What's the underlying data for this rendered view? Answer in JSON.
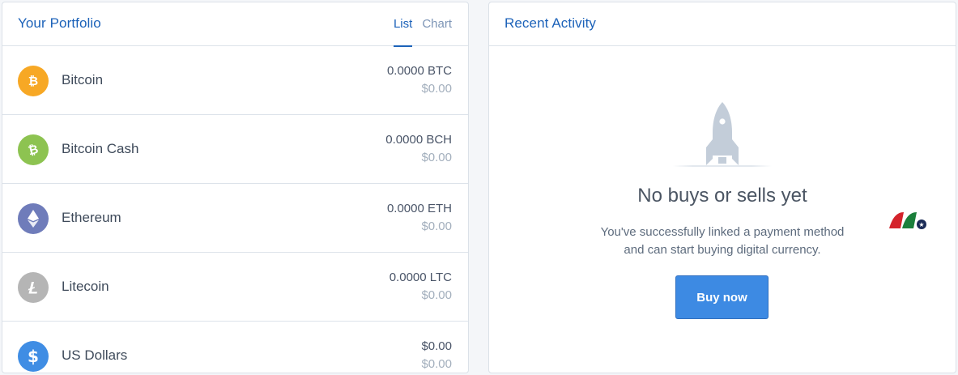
{
  "portfolio": {
    "title": "Your Portfolio",
    "tabs": [
      {
        "label": "List",
        "active": true
      },
      {
        "label": "Chart",
        "active": false
      }
    ],
    "assets": [
      {
        "name": "Bitcoin",
        "amount": "0.0000 BTC",
        "value": "$0.00",
        "icon": "bitcoin-icon",
        "color": "#f7a825"
      },
      {
        "name": "Bitcoin Cash",
        "amount": "0.0000 BCH",
        "value": "$0.00",
        "icon": "bitcoin-cash-icon",
        "color": "#8dc351"
      },
      {
        "name": "Ethereum",
        "amount": "0.0000 ETH",
        "value": "$0.00",
        "icon": "ethereum-icon",
        "color": "#6f7cba"
      },
      {
        "name": "Litecoin",
        "amount": "0.0000 LTC",
        "value": "$0.00",
        "icon": "litecoin-icon",
        "color": "#b5b5b5"
      },
      {
        "name": "US Dollars",
        "amount": "$0.00",
        "value": "$0.00",
        "icon": "dollar-icon",
        "color": "#3f8de4"
      }
    ]
  },
  "activity": {
    "title": "Recent Activity",
    "empty_title": "No buys or sells yet",
    "empty_text_line1": "You've successfully linked a payment method",
    "empty_text_line2": "and can start buying digital currency.",
    "buy_button_label": "Buy now"
  },
  "colors": {
    "accent": "#1c62b9",
    "button": "#3d8ae3",
    "rocket": "#c3cdd9"
  }
}
